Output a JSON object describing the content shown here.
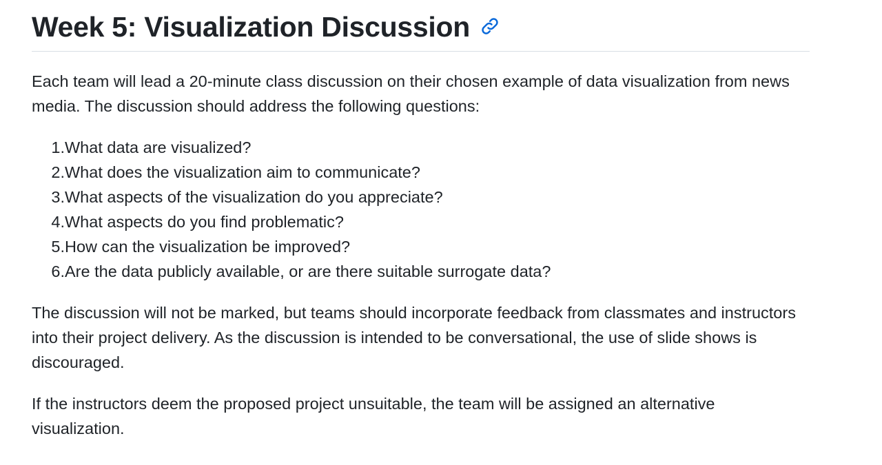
{
  "page": {
    "title": "Week 5: Visualization Discussion",
    "anchor_icon": "link-icon",
    "accent_color": "#0969da"
  },
  "body": {
    "intro": "Each team will lead a 20-minute class discussion on their chosen example of data visualization from news media. The discussion should address the following questions:",
    "questions": [
      {
        "number": "1.",
        "text": " What data are visualized?"
      },
      {
        "number": "2.",
        "text": " What does the visualization aim to communicate?"
      },
      {
        "number": "3.",
        "text": " What aspects of the visualization do you appreciate?"
      },
      {
        "number": "4.",
        "text": " What aspects do you find problematic?"
      },
      {
        "number": "5.",
        "text": " How can the visualization be improved?"
      },
      {
        "number": "6.",
        "text": " Are the data publicly available, or are there suitable surrogate data?"
      }
    ],
    "feedback_note": "The discussion will not be marked, but teams should incorporate feedback from classmates and instructors into their project delivery. As the discussion is intended to be conversational, the use of slide shows is discouraged.",
    "alternative_note": "If the instructors deem the proposed project unsuitable, the team will be assigned an alternative visualization."
  }
}
